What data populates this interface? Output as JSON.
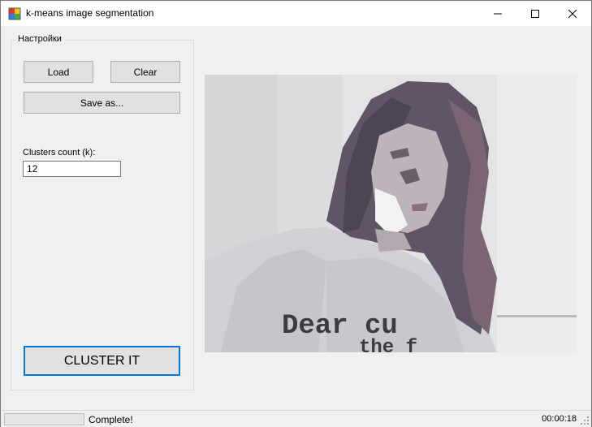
{
  "window": {
    "title": "k-means image segmentation"
  },
  "settings": {
    "group_label": "Настройки",
    "load_label": "Load",
    "clear_label": "Clear",
    "save_label": "Save as...",
    "k_label": "Clusters count (k):",
    "k_value": "12",
    "cluster_label": "CLUSTER IT"
  },
  "image": {
    "caption_line1": "Dear cu",
    "caption_line2": "the f"
  },
  "status": {
    "progress": 0,
    "text": "Complete!",
    "elapsed": "00:00:18"
  }
}
